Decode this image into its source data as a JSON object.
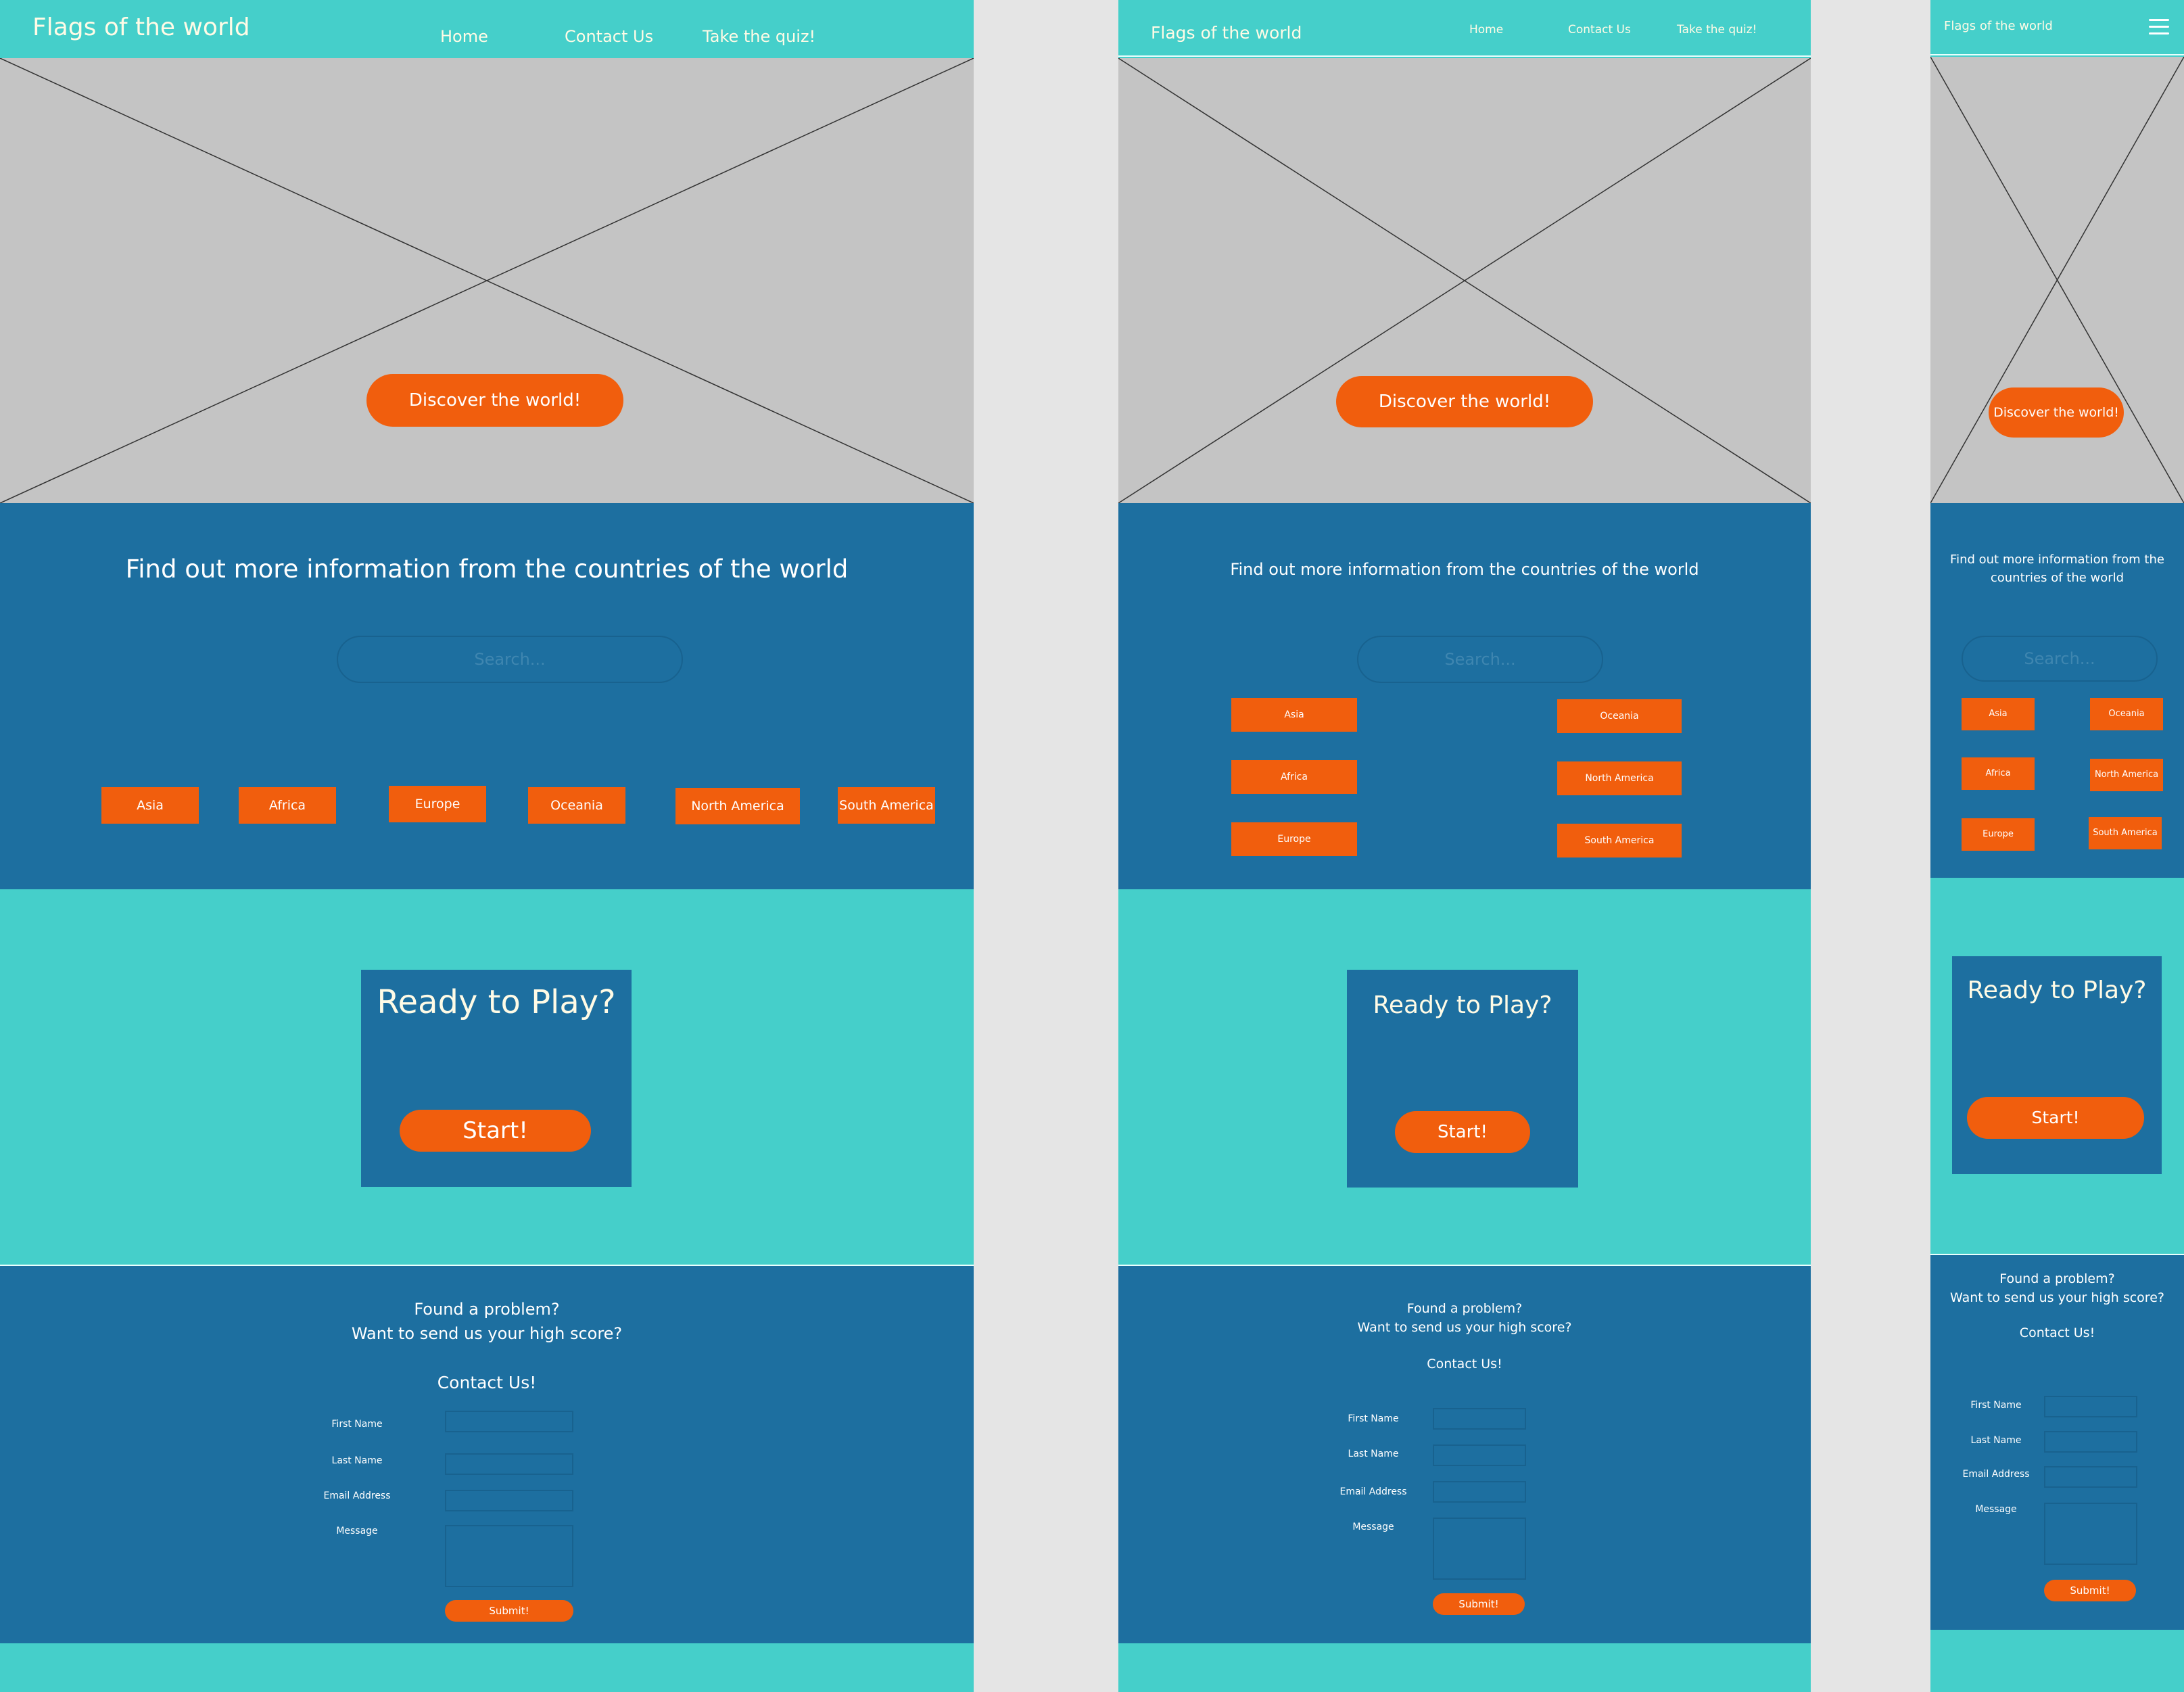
{
  "site": {
    "title": "Flags of the world"
  },
  "nav": {
    "home": "Home",
    "contact": "Contact Us",
    "quiz": "Take the quiz!"
  },
  "hero": {
    "button": "Discover the world!"
  },
  "info": {
    "title": "Find out more information from the countries of the world",
    "search_placeholder": "Search...",
    "continents": [
      "Asia",
      "Africa",
      "Europe",
      "Oceania",
      "North America",
      "South America"
    ]
  },
  "quiz": {
    "title": "Ready to Play?",
    "start": "Start!"
  },
  "contact": {
    "line1": "Found a problem?",
    "line2": "Want to send us your high score?",
    "heading": "Contact Us!",
    "labels": [
      "First Name",
      "Last Name",
      "Email Address",
      "Message"
    ],
    "submit": "Submit!"
  },
  "icons": {
    "menu": "hamburger-menu-icon",
    "placeholder_image": "image-placeholder-icon"
  },
  "colors": {
    "teal": "#45cfca",
    "blue": "#1d6fa0",
    "orange": "#f15e0d",
    "grey": "#c4c4c4"
  }
}
